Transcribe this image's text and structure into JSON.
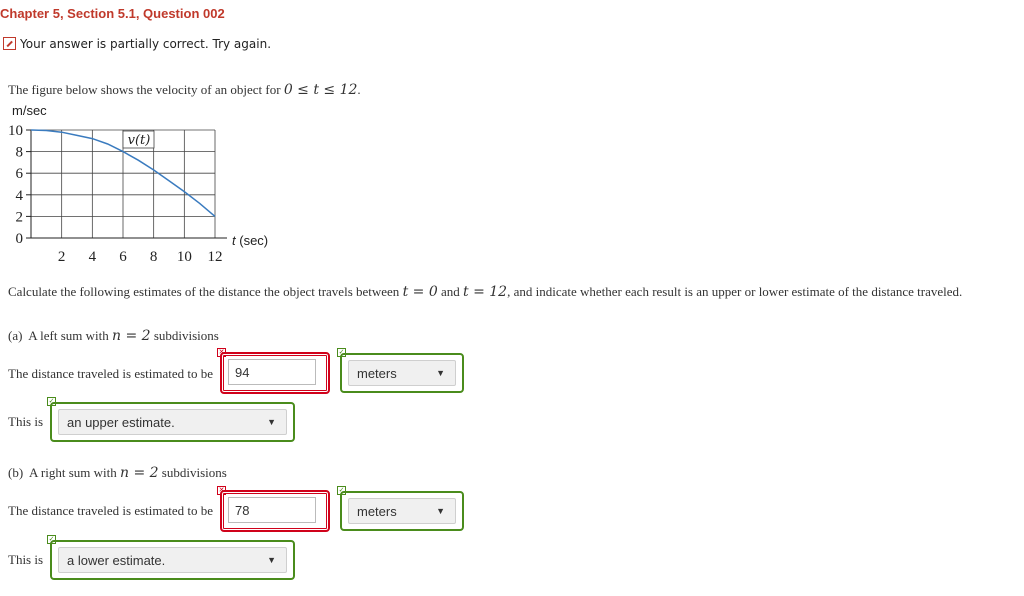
{
  "header": {
    "title": "Chapter 5, Section 5.1, Question 002",
    "status": "Your answer is partially correct.  Try again."
  },
  "problem": {
    "intro": "The figure below shows the velocity of an object for",
    "intro_range": "0 ≤ t ≤ 12",
    "instructions_a": "Calculate the following estimates of the distance the object travels between",
    "t0": "t = 0",
    "and": "and",
    "t12": "t = 12",
    "instructions_b": ", and indicate whether each result is an upper or lower estimate of the distance traveled."
  },
  "chart_data": {
    "type": "line",
    "ylabel": "m/sec",
    "xlabel": "t (sec)",
    "series_label": "v(t)",
    "xlim": [
      0,
      12
    ],
    "ylim": [
      0,
      10
    ],
    "x_ticks": [
      "2",
      "4",
      "6",
      "8",
      "10",
      "12"
    ],
    "y_ticks": [
      "10",
      "8",
      "6",
      "4",
      "2",
      "0"
    ],
    "grid": true,
    "x": [
      0,
      1,
      2,
      3,
      4,
      5,
      6,
      7,
      8,
      9,
      10,
      11,
      12
    ],
    "values": [
      10,
      9.95,
      9.8,
      9.5,
      9.2,
      8.7,
      8,
      7.2,
      6.3,
      5.3,
      4.3,
      3.2,
      2
    ]
  },
  "part_a": {
    "label": "(a)",
    "desc_pre": "A left sum with",
    "n_eq": "n = 2",
    "desc_post": "subdivisions",
    "distance_label": "The distance traveled is estimated to be",
    "distance_value": "94",
    "units_value": "meters",
    "this_is": "This is",
    "estimate_value": "an upper estimate.",
    "distance_mark": "✕",
    "units_mark": "✓",
    "estimate_mark": "✓"
  },
  "part_b": {
    "label": "(b)",
    "desc_pre": "A right sum with",
    "n_eq": "n = 2",
    "desc_post": "subdivisions",
    "distance_label": "The distance traveled is estimated to be",
    "distance_value": "78",
    "units_value": "meters",
    "this_is": "This is",
    "estimate_value": "a lower estimate.",
    "distance_mark": "✕",
    "units_mark": "✓",
    "estimate_mark": "✓"
  },
  "colors": {
    "title": "#c0392b",
    "incorrect": "#d0021b",
    "correct": "#4a8c1c",
    "curve": "#3a7bbf"
  }
}
